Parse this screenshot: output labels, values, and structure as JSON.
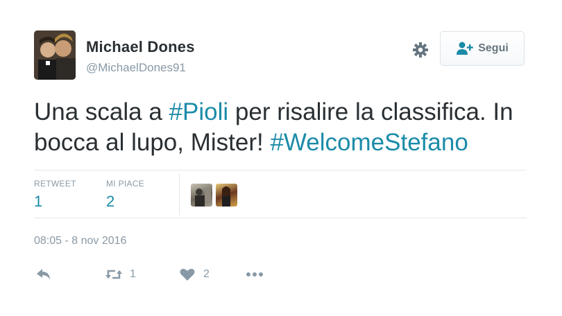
{
  "author": {
    "name": "Michael Dones",
    "handle": "@MichaelDones91"
  },
  "follow_button": {
    "label": "Segui",
    "icon": "add-user-icon"
  },
  "settings": {
    "icon": "gear-icon"
  },
  "tweet": {
    "parts": [
      {
        "text": "Una scala a ",
        "hashtag": false
      },
      {
        "text": "#Pioli",
        "hashtag": true
      },
      {
        "text": " per risalire la classifica. In bocca al lupo, Mister! ",
        "hashtag": false
      },
      {
        "text": "#WelcomeStefano",
        "hashtag": true
      }
    ]
  },
  "stats": {
    "retweets_label": "RETWEET",
    "retweets_count": "1",
    "likes_label": "MI PIACE",
    "likes_count": "2"
  },
  "timestamp": "08:05 - 8 nov 2016",
  "actions": {
    "reply_icon": "reply-icon",
    "retweet_icon": "retweet-icon",
    "retweet_count": "1",
    "like_icon": "heart-icon",
    "like_count": "2",
    "more_icon": "more-icon"
  },
  "colors": {
    "link": "#1b8ba8",
    "muted": "#8899a6",
    "text": "#292f33"
  }
}
